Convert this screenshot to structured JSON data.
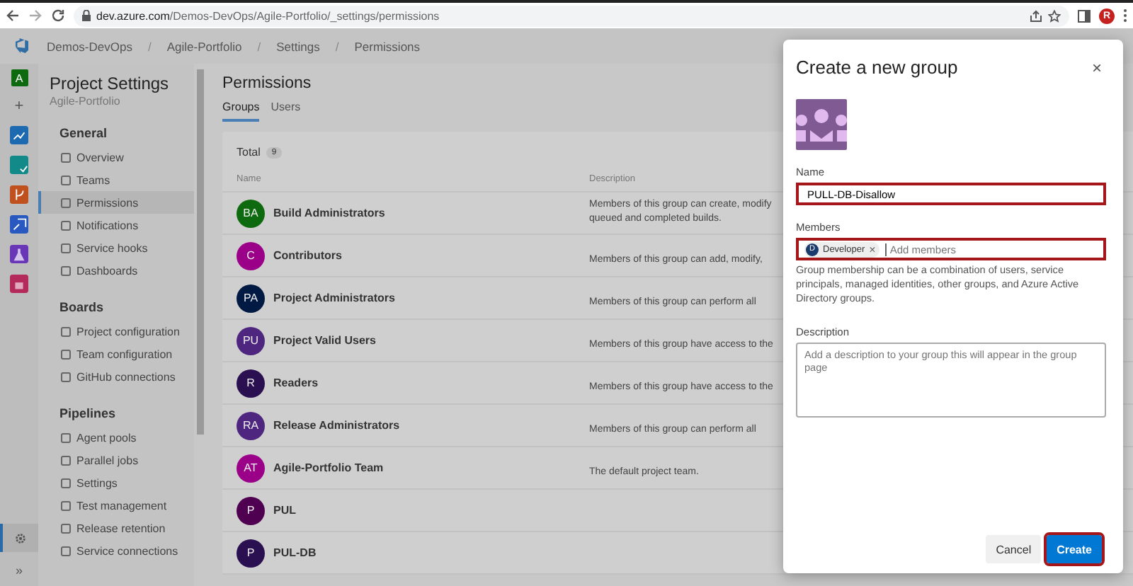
{
  "browser": {
    "url_host": "dev.azure.com",
    "url_path": "/Demos-DevOps/Agile-Portfolio/_settings/permissions",
    "profile_initial": "R"
  },
  "breadcrumb": {
    "separator": "/",
    "items": [
      "Demos-DevOps",
      "Agile-Portfolio",
      "Settings",
      "Permissions"
    ]
  },
  "rail": {
    "project_initial": "A",
    "add_label": "+",
    "settings_selected": true,
    "expand_label": "»"
  },
  "sidebar": {
    "title": "Project Settings",
    "subtitle": "Agile-Portfolio",
    "sections": [
      {
        "heading": "General",
        "items": [
          {
            "label": "Overview",
            "selected": false
          },
          {
            "label": "Teams",
            "selected": false
          },
          {
            "label": "Permissions",
            "selected": true
          },
          {
            "label": "Notifications",
            "selected": false
          },
          {
            "label": "Service hooks",
            "selected": false
          },
          {
            "label": "Dashboards",
            "selected": false
          }
        ]
      },
      {
        "heading": "Boards",
        "items": [
          {
            "label": "Project configuration",
            "selected": false
          },
          {
            "label": "Team configuration",
            "selected": false
          },
          {
            "label": "GitHub connections",
            "selected": false
          }
        ]
      },
      {
        "heading": "Pipelines",
        "items": [
          {
            "label": "Agent pools",
            "selected": false
          },
          {
            "label": "Parallel jobs",
            "selected": false
          },
          {
            "label": "Settings",
            "selected": false
          },
          {
            "label": "Test management",
            "selected": false
          },
          {
            "label": "Release retention",
            "selected": false
          },
          {
            "label": "Service connections",
            "selected": false
          }
        ]
      }
    ]
  },
  "main": {
    "title": "Permissions",
    "tabs": [
      {
        "label": "Groups",
        "selected": true
      },
      {
        "label": "Users",
        "selected": false
      }
    ],
    "total_label": "Total",
    "total_count": "9",
    "columns": [
      "Name",
      "Description"
    ],
    "rows": [
      {
        "initials": "BA",
        "color": "#0e6a0e",
        "name": "Build Administrators",
        "description_lines": [
          "Members of this group can create, modify",
          "queued and completed builds."
        ]
      },
      {
        "initials": "C",
        "color": "#9a0088",
        "name": "Contributors",
        "description_lines": [
          "Members of this group can add, modify,"
        ]
      },
      {
        "initials": "PA",
        "color": "#001a44",
        "name": "Project Administrators",
        "description_lines": [
          "Members of this group can perform all"
        ]
      },
      {
        "initials": "PU",
        "color": "#4e2680",
        "name": "Project Valid Users",
        "description_lines": [
          "Members of this group have access to the"
        ]
      },
      {
        "initials": "R",
        "color": "#2a1050",
        "name": "Readers",
        "description_lines": [
          "Members of this group have access to the"
        ]
      },
      {
        "initials": "RA",
        "color": "#4e2680",
        "name": "Release Administrators",
        "description_lines": [
          "Members of this group can perform all"
        ]
      },
      {
        "initials": "AT",
        "color": "#9a0088",
        "name": "Agile-Portfolio Team",
        "description_lines": [
          "The default project team."
        ]
      },
      {
        "initials": "P",
        "color": "#500050",
        "name": "PUL",
        "description_lines": []
      },
      {
        "initials": "P",
        "color": "#2a1050",
        "name": "PUL-DB",
        "description_lines": []
      }
    ]
  },
  "dialog": {
    "title": "Create a new group",
    "close": "×",
    "name_label": "Name",
    "name_value": "PULL-DB-Disallow",
    "name_highlighted": true,
    "members_label": "Members",
    "members": [
      {
        "initial": "D",
        "name": "Developer",
        "remove": "×"
      }
    ],
    "members_placeholder": "Add members",
    "members_highlighted": true,
    "members_help": "Group membership can be a combination of users, service principals, managed identities, other groups, and Azure Active Directory groups.",
    "description_label": "Description",
    "description_placeholder": "Add a description to your group this will appear in the group page",
    "buttons": [
      {
        "label": "Cancel",
        "kind": "secondary",
        "highlighted": false
      },
      {
        "label": "Create",
        "kind": "primary",
        "highlighted": true
      }
    ]
  }
}
